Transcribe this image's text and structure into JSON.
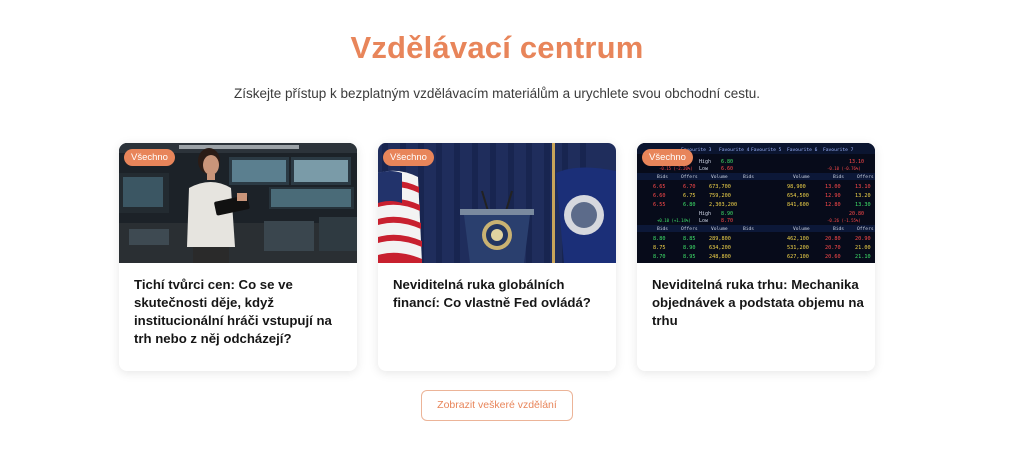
{
  "header": {
    "title": "Vzdělávací centrum",
    "subtitle": "Získejte přístup k bezplatným vzdělávacím materiálům a urychlete svou obchodní cestu."
  },
  "colors": {
    "accent": "#e8855a",
    "text": "#161616",
    "muted": "#3b3b3b"
  },
  "cards": [
    {
      "badge": "Všechno",
      "title": "Tichí tvůrci cen: Co se ve skutečnosti děje, když institucionální hráči vstupují na trh nebo z něj odcházejí?"
    },
    {
      "badge": "Všechno",
      "title": "Neviditelná ruka globálních financí: Co vlastně Fed ovládá?"
    },
    {
      "badge": "Všechno",
      "title": "Neviditelná ruka trhu: Mechanika objednávek a podstata objemu na trhu"
    }
  ],
  "order_board": {
    "tabs": [
      "Favourite 3",
      "Favourite 4",
      "Favourite 5",
      "Favourite 6",
      "Favourite 7"
    ],
    "col_headers": [
      "Bids",
      "Offers",
      "Volume",
      "Bids",
      "Offers"
    ],
    "hi_lo": [
      {
        "h": "High",
        "hv": "6.80",
        "l": "Low",
        "lv": "6.60"
      },
      {
        "h": "High",
        "hv": "8.90",
        "l": "Low",
        "lv": "8.70"
      }
    ],
    "changes": [
      "-0.15 (-2.20%)",
      "+0.10 (+1.14%)",
      "-0.10 (-0.76%)",
      "-0.26 (-1.55%)"
    ],
    "prices_right": [
      "13.10",
      "20.80"
    ],
    "block_a": [
      [
        "6.65",
        "6.70",
        "673,700"
      ],
      [
        "6.60",
        "6.75",
        "759,200"
      ],
      [
        "6.55",
        "6.80",
        "2,303,200"
      ]
    ],
    "block_b": [
      [
        "8.80",
        "8.85",
        "289,800"
      ],
      [
        "8.75",
        "8.90",
        "634,200"
      ],
      [
        "8.70",
        "8.95",
        "248,800"
      ]
    ],
    "block_c": [
      [
        "98,900",
        "13.00",
        "13.10"
      ],
      [
        "654,500",
        "12.90",
        "13.20"
      ],
      [
        "841,600",
        "12.80",
        "13.30"
      ]
    ],
    "block_d": [
      [
        "462,100",
        "20.80",
        "20.90"
      ],
      [
        "531,200",
        "20.70",
        "21.00"
      ],
      [
        "627,100",
        "20.60",
        "21.10"
      ]
    ]
  },
  "actions": {
    "show_all_label": "Zobrazit veškeré vzdělání"
  }
}
